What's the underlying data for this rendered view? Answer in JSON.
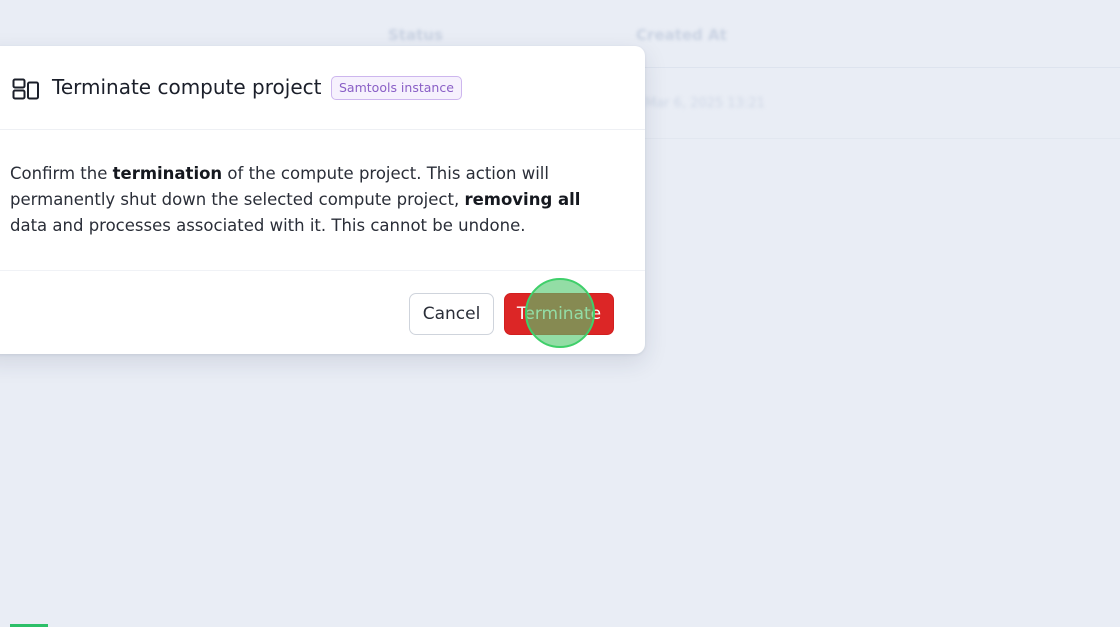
{
  "background": {
    "column_status": "Status",
    "column_created": "Created At",
    "row_created_text": "Mar 6, 2025 13:21"
  },
  "modal": {
    "icon": "layout-panels-icon",
    "title": "Terminate compute project",
    "badge": "Samtools instance",
    "body": {
      "part1": "Confirm the ",
      "bold1": "termination",
      "part2": " of the compute project. This action will permanently shut down the selected compute project, ",
      "bold2": "removing all",
      "part3": " data and processes associated with it. This cannot be undone."
    },
    "buttons": {
      "cancel": "Cancel",
      "terminate": "Terminate"
    }
  },
  "colors": {
    "danger": "#dc2626",
    "badge_text": "#8a5fc6",
    "click_indicator": "#3fcf6a"
  }
}
